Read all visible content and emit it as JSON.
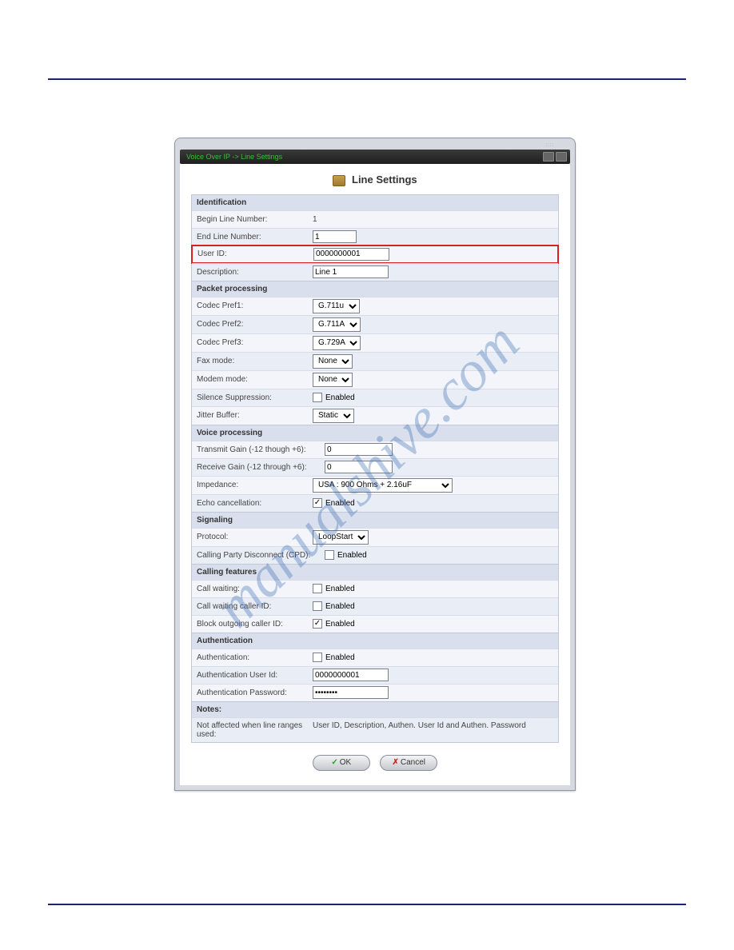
{
  "watermark": "manualshive.com",
  "breadcrumb": "Voice Over IP -> Line Settings",
  "page_title": "Line Settings",
  "sections": {
    "identification": {
      "header": "Identification",
      "begin_line_label": "Begin Line Number:",
      "begin_line_value": "1",
      "end_line_label": "End Line Number:",
      "end_line_value": "1",
      "user_id_label": "User ID:",
      "user_id_value": "0000000001",
      "description_label": "Description:",
      "description_value": "Line 1"
    },
    "packet": {
      "header": "Packet processing",
      "codec1_label": "Codec Pref1:",
      "codec1_value": "G.711u",
      "codec2_label": "Codec Pref2:",
      "codec2_value": "G.711A",
      "codec3_label": "Codec Pref3:",
      "codec3_value": "G.729A",
      "fax_label": "Fax mode:",
      "fax_value": "None",
      "modem_label": "Modem mode:",
      "modem_value": "None",
      "silence_label": "Silence Suppression:",
      "jitter_label": "Jitter Buffer:",
      "jitter_value": "Static"
    },
    "voice": {
      "header": "Voice processing",
      "tx_gain_label": "Transmit Gain (-12 though +6):",
      "tx_gain_value": "0",
      "rx_gain_label": "Receive Gain (-12 through +6):",
      "rx_gain_value": "0",
      "impedance_label": "Impedance:",
      "impedance_value": "USA : 900 Ohms + 2.16uF",
      "echo_label": "Echo cancellation:"
    },
    "signaling": {
      "header": "Signaling",
      "protocol_label": "Protocol:",
      "protocol_value": "LoopStart",
      "cpd_label": "Calling Party Disconnect (CPD):"
    },
    "calling": {
      "header": "Calling features",
      "call_waiting_label": "Call waiting:",
      "cw_caller_id_label": "Call waiting caller ID:",
      "block_out_label": "Block outgoing caller ID:"
    },
    "auth": {
      "header": "Authentication",
      "auth_label": "Authentication:",
      "auth_user_label": "Authentication User Id:",
      "auth_user_value": "0000000001",
      "auth_pw_label": "Authentication Password:",
      "auth_pw_value": "••••••••"
    },
    "notes": {
      "header": "Notes:",
      "label": "Not affected when line ranges used:",
      "value": "User ID, Description, Authen. User Id and Authen. Password"
    }
  },
  "enabled_text": "Enabled",
  "buttons": {
    "ok": "OK",
    "cancel": "Cancel"
  }
}
